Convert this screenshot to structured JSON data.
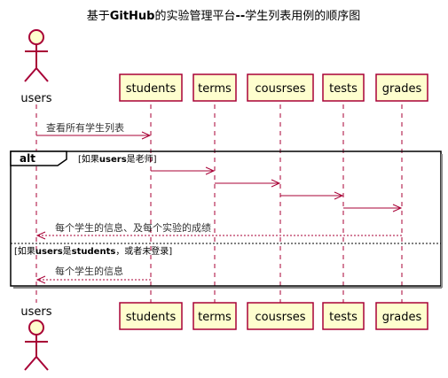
{
  "title": {
    "prefix": "基于",
    "bold1": "GitHub",
    "middle": "的实验管理平台",
    "bold2": "--",
    "suffix": "学生列表用例的顺序图"
  },
  "actor": {
    "name": "users"
  },
  "participants": [
    "students",
    "terms",
    "cousrses",
    "tests",
    "grades"
  ],
  "messages": {
    "m1": "查看所有学生列表",
    "m6": "每个学生的信息、及每个实验的成绩",
    "m7": "每个学生的信息"
  },
  "fragment": {
    "keyword": "alt",
    "guard1": {
      "open": "[如果",
      "bold": "users",
      "close": "是老师]"
    },
    "guard2": {
      "open": "[如果",
      "bold1": "users",
      "mid": "是",
      "bold2": "students",
      "close": "，或者未登录]"
    }
  },
  "colors": {
    "border": "#A80036",
    "fill": "#FEFECE"
  }
}
